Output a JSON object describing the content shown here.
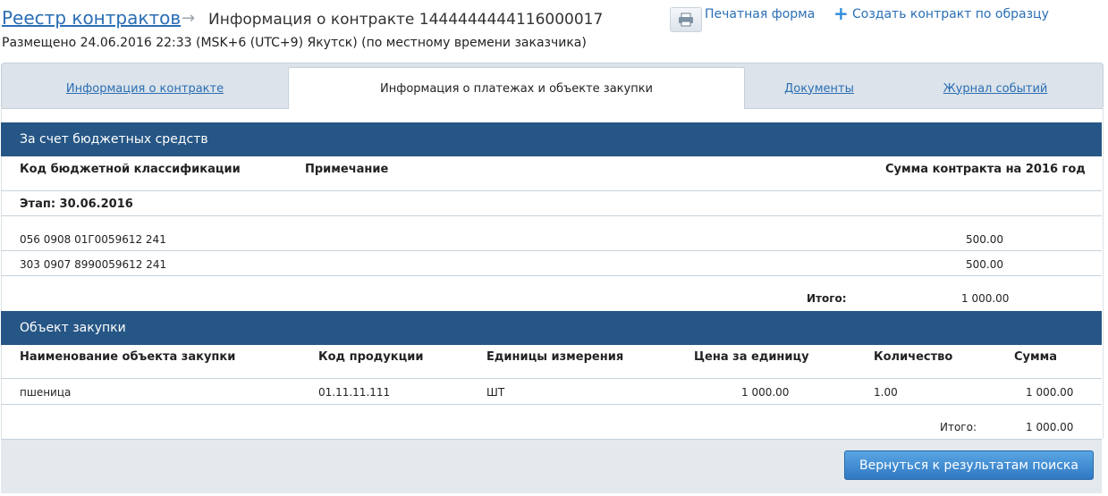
{
  "header": {
    "breadcrumb_link": "Реестр контрактов",
    "arrow": "→",
    "title": "Информация о контракте 1444444444116000017",
    "posted": "Размещено 24.06.2016 22:33 (MSK+6 (UTC+9) Якутск) (по местному времени заказчика)",
    "print_label": "Печатная форма",
    "create_plus": "+",
    "create_label": "Создать контракт по образцу"
  },
  "tabs": [
    {
      "label": "Информация о контракте"
    },
    {
      "label": "Информация о платежах и объекте закупки"
    },
    {
      "label": "Документы"
    },
    {
      "label": "Журнал событий"
    }
  ],
  "budget": {
    "title": "За счет бюджетных средств",
    "col_code": "Код бюджетной классификации",
    "col_note": "Примечание",
    "col_sum": "Сумма контракта на 2016 год",
    "stage": "Этап: 30.06.2016",
    "rows": [
      {
        "code": "056 0908 01Г0059612 241",
        "sum": "500.00"
      },
      {
        "code": "303 0907 8990059612 241",
        "sum": "500.00"
      }
    ],
    "total_label": "Итого:",
    "total_value": "1 000.00"
  },
  "object": {
    "title": "Объект закупки",
    "col_name": "Наименование объекта закупки",
    "col_code": "Код продукции",
    "col_unit": "Единицы измерения",
    "col_price": "Цена за единицу",
    "col_qty": "Количество",
    "col_sum": "Сумма",
    "rows": [
      {
        "name": "пшеница",
        "code": "01.11.11.111",
        "unit": "ШТ",
        "price": "1 000.00",
        "qty": "1.00",
        "sum": "1 000.00"
      }
    ],
    "total_label": "Итого:",
    "total_value": "1 000.00"
  },
  "footer": {
    "back_label": "Вернуться к результатам поиска"
  }
}
